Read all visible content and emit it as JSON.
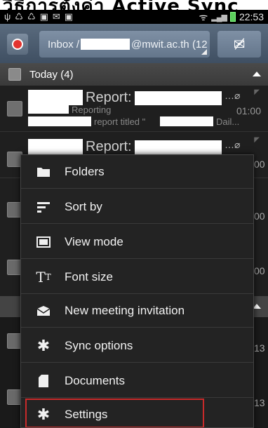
{
  "caption": {
    "text": "วิธีการตั้งค่า Active Sync"
  },
  "status": {
    "time": "22:53",
    "icons": [
      "usb-icon",
      "recycle-icon",
      "recycle-icon",
      "image-icon",
      "mail-icon",
      "image-icon"
    ]
  },
  "header": {
    "account_prefix": "Inbox /",
    "account_suffix": "@mwit.ac.th (12",
    "compose_icon": "compose-mail-icon"
  },
  "section_today": {
    "label": "Today",
    "count": "(4)"
  },
  "emails": [
    {
      "subject": "Report:",
      "preview1": "Reporting",
      "preview2": "report titled \"",
      "preview3": "Dail...",
      "time": "01:00",
      "attachment": true
    },
    {
      "subject": "Report:",
      "time": "00",
      "attachment": true
    }
  ],
  "bg_times": [
    "00",
    "00",
    "13",
    "13"
  ],
  "menu": {
    "items": [
      {
        "label": "Folders",
        "icon": "folder-icon"
      },
      {
        "label": "Sort by",
        "icon": "sort-icon"
      },
      {
        "label": "View mode",
        "icon": "view-mode-icon"
      },
      {
        "label": "Font size",
        "icon": "font-size-icon"
      },
      {
        "label": "New meeting invitation",
        "icon": "meeting-invitation-icon"
      },
      {
        "label": "Sync options",
        "icon": "sync-gear-icon"
      },
      {
        "label": "Documents",
        "icon": "document-icon"
      },
      {
        "label": "Settings",
        "icon": "settings-gear-icon"
      }
    ],
    "highlight_color": "#c82a2a"
  },
  "colors": {
    "header": "#4f6073",
    "accent_red": "#e3342f",
    "battery": "#5cd05c"
  }
}
